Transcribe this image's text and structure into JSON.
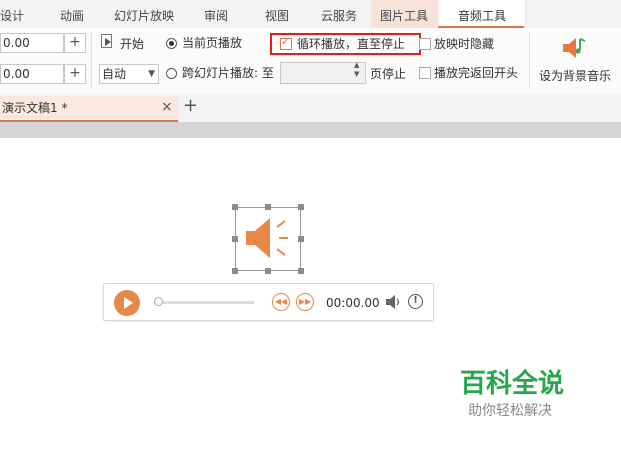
{
  "tabs": [
    "设计",
    "动画",
    "幻灯片放映",
    "审阅",
    "视图",
    "云服务",
    "图片工具",
    "音频工具"
  ],
  "ribbon": {
    "volume_value": "0.00",
    "fade_value": "0.00",
    "start_label": "开始",
    "auto_select": "自动",
    "current_page_label": "当前页播放",
    "cross_slide_label": "跨幻灯片播放: 至",
    "page_stop_label": "页停止",
    "loop_label": "循环播放，直至停止",
    "hide_label": "放映时隐藏",
    "rewind_label": "播放完返回开头",
    "bg_music_label": "设为背景音乐"
  },
  "document": {
    "tab_label": "演示文稿1 *",
    "close_symbol": "×",
    "new_tab_symbol": "+"
  },
  "player": {
    "time": "00:00.00",
    "progress": 0
  },
  "watermark": {
    "title": "百科全说",
    "subtitle": "助你轻松解决"
  },
  "colors": {
    "accent": "#d6744a",
    "highlight_box": "#e02020",
    "watermark": "#27a64a"
  }
}
